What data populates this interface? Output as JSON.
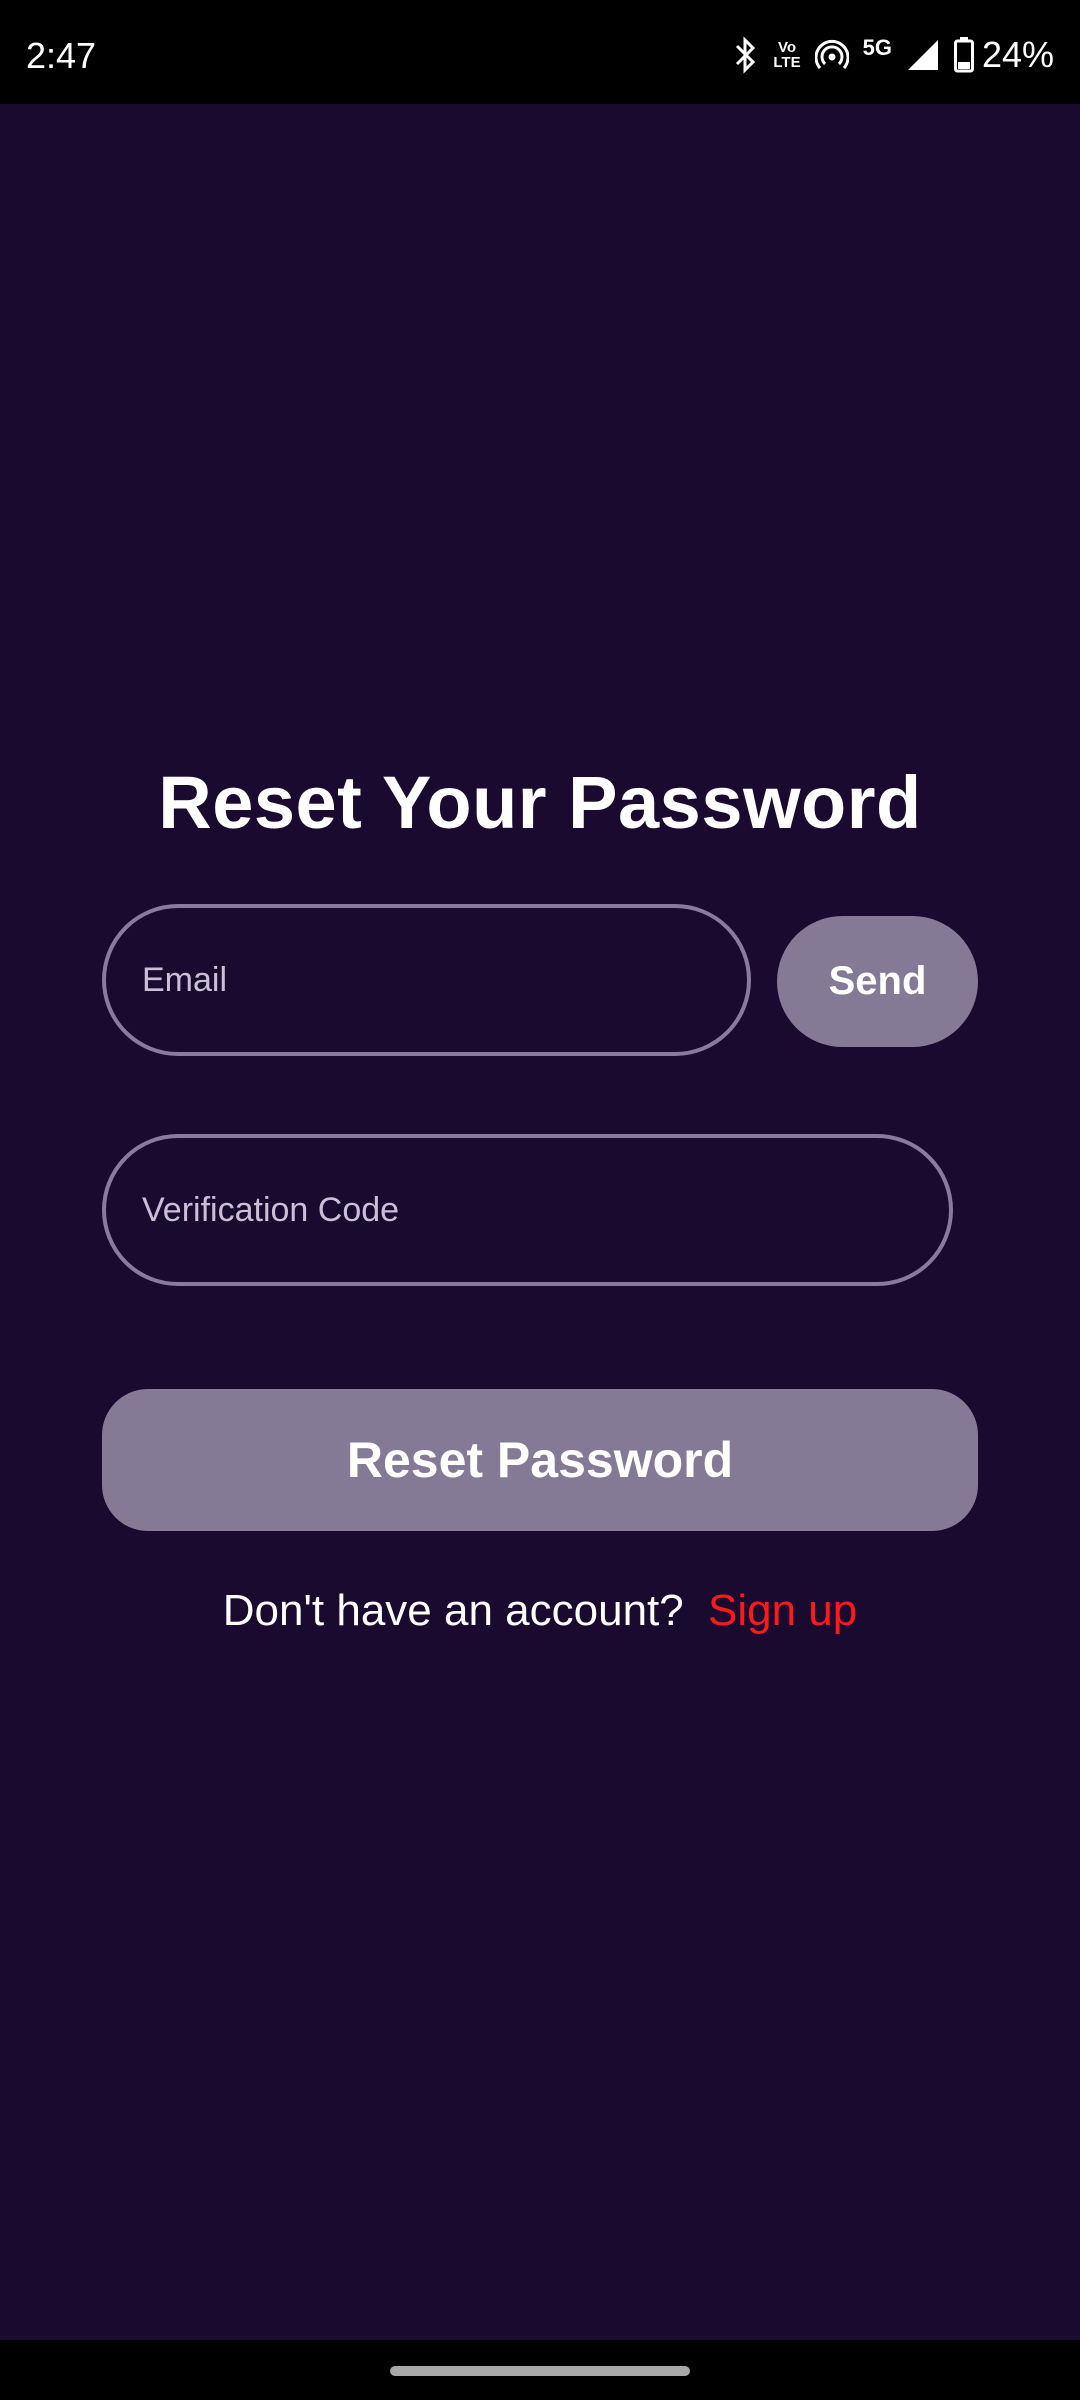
{
  "status_bar": {
    "time": "2:47",
    "volte_top": "Vo",
    "volte_bottom": "LTE",
    "network": "5G",
    "battery": "24%",
    "icons": [
      "bluetooth-icon",
      "volte-icon",
      "hotspot-icon",
      "5g-icon",
      "signal-icon",
      "battery-icon"
    ]
  },
  "screen": {
    "title": "Reset Your Password",
    "email_placeholder": "Email",
    "send_label": "Send",
    "code_placeholder": "Verification Code",
    "reset_label": "Reset Password",
    "signup_prompt": "Don't have an account?",
    "signup_link": "Sign up"
  },
  "colors": {
    "background": "#1b0a30",
    "button": "#857a95",
    "field_border": "#8c7a9e",
    "link": "#ff1a1a"
  }
}
